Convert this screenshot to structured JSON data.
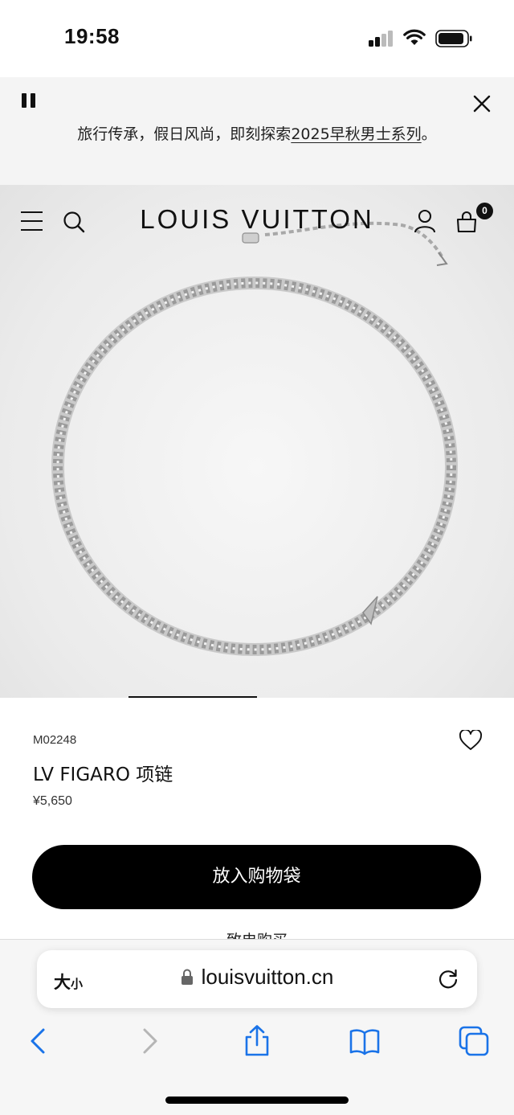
{
  "status_bar": {
    "time": "19:58"
  },
  "banner": {
    "text_prefix": "旅行传承，假日风尚，即刻探索",
    "link_text": "2025早秋男士系列",
    "text_suffix": "。"
  },
  "header": {
    "brand": "LOUIS VUITTON",
    "bag_count": "0"
  },
  "product": {
    "sku": "M02248",
    "name": "LV FIGARO 项链",
    "price": "¥5,650",
    "add_to_bag_label": "放入购物袋",
    "call_to_buy_label": "致电购买"
  },
  "browser": {
    "text_size_label_big": "大",
    "text_size_label_small": "小",
    "url": "louisvuitton.cn"
  },
  "colors": {
    "accent": "#000000",
    "link_blue": "#1a73e8",
    "banner_bg": "#f4f4f4"
  }
}
